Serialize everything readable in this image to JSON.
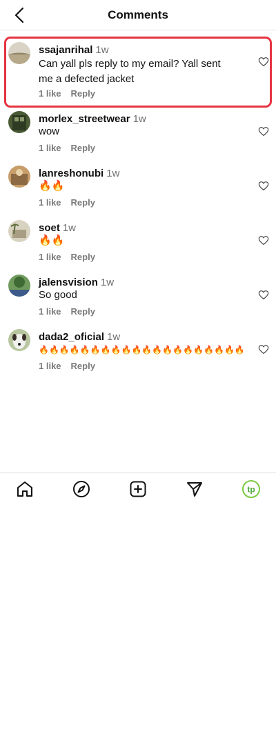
{
  "header": {
    "title": "Comments"
  },
  "comments": [
    {
      "username": "ssajanrihal",
      "time": "1w",
      "text": "Can yall pls reply to my email? Yall sent me a defected jacket",
      "likes": "1 like",
      "reply_label": "Reply",
      "avatar": "lake-landscape"
    },
    {
      "username": "morlex_streetwear",
      "time": "1w",
      "text": "wow",
      "likes": "1 like",
      "reply_label": "Reply",
      "avatar": "train-photo"
    },
    {
      "username": "lanreshonubi",
      "time": "1w",
      "text": "🔥🔥",
      "likes": "1 like",
      "reply_label": "Reply",
      "avatar": "mall-interior"
    },
    {
      "username": "soet",
      "time": "1w",
      "text": "🔥🔥",
      "likes": "1 like",
      "reply_label": "Reply",
      "avatar": "palm-building"
    },
    {
      "username": "jalensvision",
      "time": "1w",
      "text": "So good",
      "likes": "1 like",
      "reply_label": "Reply",
      "avatar": "tree-landscape"
    },
    {
      "username": "dada2_oficial",
      "time": "1w",
      "text": "🔥🔥🔥🔥🔥🔥🔥🔥🔥🔥🔥🔥🔥🔥🔥🔥🔥🔥🔥🔥🔥🔥🔥🔥🔥🔥🔥🔥🔥🔥🔥",
      "likes": "1 like",
      "reply_label": "Reply",
      "avatar": "dog-photo"
    }
  ],
  "nav": {
    "items": [
      "home-icon",
      "explore-icon",
      "create-icon",
      "send-icon",
      "profile-icon"
    ],
    "profile_initials": "tp"
  },
  "colors": {
    "highlight": "#e5333f",
    "profile_ring": "#7ac943",
    "meta_gray": "#7a7a7a"
  }
}
